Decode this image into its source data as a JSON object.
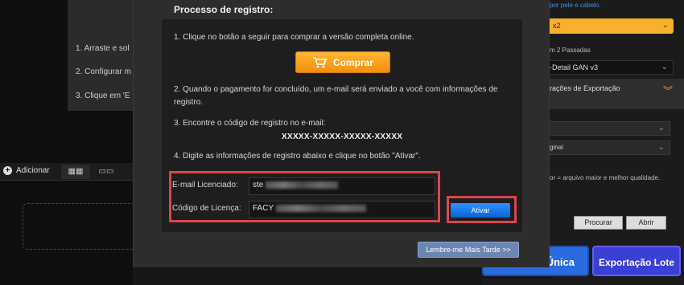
{
  "background": {
    "steps": [
      "1. Arraste e sol",
      "2. Configurar m",
      "3. Clique em 'E"
    ],
    "add_label": "Adicionar",
    "right_panel": {
      "hint_text": "por pele e cabelo.",
      "yellow_select_value": "x2",
      "passes_text": "m 2 Passadas",
      "model_select_value": "-Detail GAN  v3",
      "export_header": "rações de Exportação",
      "format_select_value": "ginal",
      "quality_note": "or = arquivo maior e melhor qualidade.",
      "browse_label": "Procurar",
      "open_label": "Abrir",
      "single_export_label": "Única",
      "batch_export_label": "Exportação Lote"
    }
  },
  "modal": {
    "title": "Processo de registro:",
    "step1": "1.  Clique no botão a seguir para comprar a versão completa online.",
    "buy_label": "Comprar",
    "step2": "2.  Quando o pagamento for concluído, um e-mail será enviado a você com informações de registro.",
    "step3": "3.  Encontre o código de registro no e-mail:",
    "code_format": "XXXXX-XXXXX-XXXXX-XXXXX",
    "step4": "4.  Digite as informações de registro abaixo e clique no botão \"Ativar\".",
    "email_label": "E-mail Licenciado:",
    "email_value": "ste",
    "code_label": "Código de Licença:",
    "code_value": "FACY",
    "activate_label": "Ativar",
    "remind_label": "Lembre-me Mais Tarde >>"
  },
  "colors": {
    "highlight_red": "#d9474b",
    "buy_orange": "#f7a11f",
    "activate_blue": "#1677ea",
    "accent_yellow": "#f7b12a"
  }
}
